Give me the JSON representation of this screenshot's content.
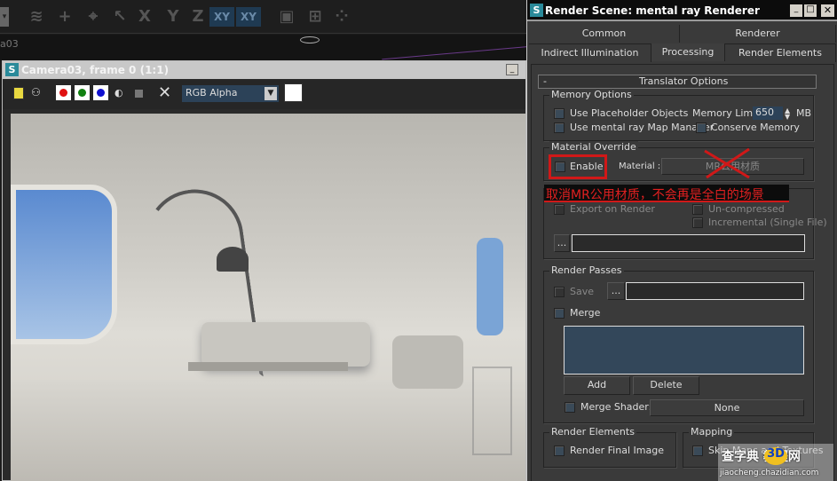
{
  "main_toolbar": {
    "axis_buttons": [
      "X",
      "Y",
      "Z",
      "XY",
      "XY"
    ],
    "viewport_label": "a03"
  },
  "frame_window": {
    "title": "Camera03, frame 0 (1:1)",
    "channel_select": "RGB Alpha",
    "channel_colors": {
      "red": "#e01010",
      "green": "#108010",
      "blue": "#1010d0"
    }
  },
  "dialog": {
    "title": "Render Scene: mental ray Renderer",
    "tabs_row1": [
      "Common",
      "Renderer"
    ],
    "tabs_row2": [
      "Indirect Illumination",
      "Processing",
      "Render Elements"
    ],
    "active_tab": "Processing",
    "rollout": {
      "toggle": "-",
      "title": "Translator Options"
    },
    "memory_options": {
      "title": "Memory Options",
      "use_placeholder": "Use Placeholder Objects",
      "memory_limit_label": "Memory Limit:",
      "memory_limit_value": "650",
      "memory_unit": "MB",
      "use_map_manager": "Use mental ray Map Manager",
      "conserve_memory": "Conserve Memory"
    },
    "material_override": {
      "title": "Material Override",
      "enable": "Enable",
      "material_label": "Material :",
      "material_button": "MR公用材质"
    },
    "export": {
      "export_on_render": "Export on Render",
      "uncompressed": "Un-compressed",
      "incremental": "Incremental (Single File)",
      "browse": "..."
    },
    "render_passes": {
      "title": "Render Passes",
      "save": "Save",
      "browse": "...",
      "merge": "Merge",
      "add": "Add",
      "delete": "Delete",
      "merge_shader_label": "Merge Shader:",
      "merge_shader_value": "None"
    },
    "render_elements": {
      "title": "Render Elements",
      "render_final_image": "Render Final Image"
    },
    "mapping": {
      "title": "Mapping",
      "skip_maps": "Skip Maps and Textures"
    }
  },
  "annotation": {
    "text": "取消MR公用材质，不会再是全白的场景",
    "color": "#e02020"
  },
  "watermark": {
    "site": "查字典 教程网",
    "url": "jiaocheng.chazidian.com",
    "logo_text": "3D"
  }
}
